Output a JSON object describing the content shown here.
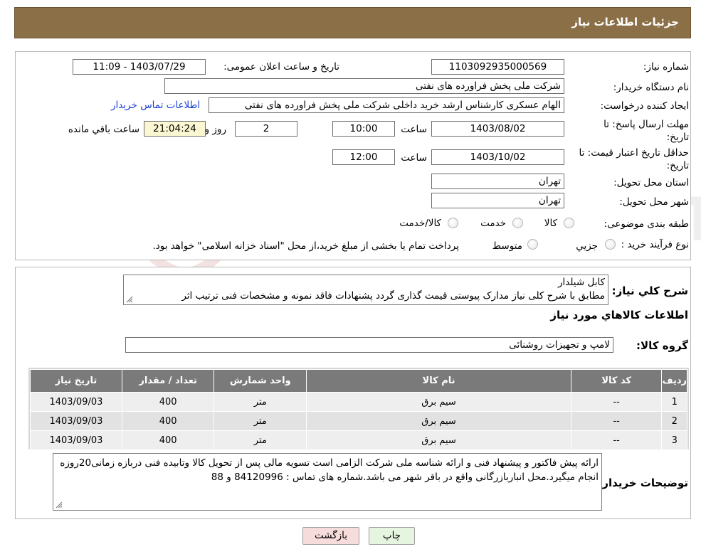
{
  "header": {
    "title": "جزئیات اطلاعات نیاز"
  },
  "form": {
    "need_number_label": "شماره نیاز:",
    "need_number": "1103092935000569",
    "announce_label": "تاریخ و ساعت اعلان عمومی:",
    "announce_value": "1403/07/29 - 11:09",
    "buyer_org_label": "نام دستگاه خریدار:",
    "buyer_org": "شرکت ملی پخش فراورده های نفتی",
    "creator_label": "ایجاد کننده درخواست:",
    "creator": "الهام عسکری کارشناس ارشد خرید داخلی شرکت ملی پخش فراورده های نفتی",
    "contact_link": "اطلاعات تماس خریدار",
    "deadline_label": "مهلت ارسال پاسخ: تا تاریخ:",
    "deadline_date": "1403/08/02",
    "time_label": "ساعت",
    "deadline_time": "10:00",
    "days_value": "2",
    "days_label": "روز و",
    "remaining_value": "21:04:24",
    "remaining_label": "ساعت باقي مانده",
    "validity_label": "حداقل تاریخ اعتبار قیمت: تا تاریخ:",
    "validity_date": "1403/10/02",
    "validity_time": "12:00",
    "province_label": "استان محل تحویل:",
    "province": "تهران",
    "city_label": "شهر محل تحویل:",
    "city": "تهران",
    "category_label": "طبقه بندی موضوعی:",
    "category_options": [
      "کالا",
      "خدمت",
      "کالا/خدمت"
    ],
    "process_label": "نوع فرآیند خرید :",
    "process_options": [
      "جزیي",
      "متوسط"
    ],
    "process_note": "پرداخت تمام یا بخشی از مبلغ خرید،از محل \"اسناد خزانه اسلامی\" خواهد بود."
  },
  "details": {
    "summary_label": "شرح کلي نیاز:",
    "summary_line1": "کابل شیلدار",
    "summary_line2": "مطابق با شرح کلی نیاز مدارک پیوستی قیمت گذاری گردد پشنهادات فاقد نمونه و مشخصات فنی ترتیب اثر",
    "goods_info_title": "اطلاعات کالاهاي مورد نیاز",
    "group_label": "گروه کالا:",
    "group_value": "لامپ و تجهیزات روشنائی",
    "table": {
      "headers": [
        "ردیف",
        "کد کالا",
        "نام کالا",
        "واحد شمارش",
        "تعداد / مقدار",
        "تاریخ نیاز"
      ],
      "rows": [
        [
          "1",
          "--",
          "سیم برق",
          "متر",
          "400",
          "1403/09/03"
        ],
        [
          "2",
          "--",
          "سیم برق",
          "متر",
          "400",
          "1403/09/03"
        ],
        [
          "3",
          "--",
          "سیم برق",
          "متر",
          "400",
          "1403/09/03"
        ]
      ]
    },
    "buyer_notes_label": "توضیحات خریدار:",
    "buyer_notes": "ارائه پیش فاکتور و پیشنهاد فنی و ارائه شناسه ملی شرکت الزامی است تسویه مالی پس از تحویل کالا وتابیده فنی دربازه زمانی20روزه انجام میگیرد.محل انباربازرگانی واقع در باقر شهر می باشد.شماره های تماس : 84120996 و 88"
  },
  "buttons": {
    "print": "چاپ",
    "back": "بازگشت"
  },
  "watermark": {
    "text": "AriaTender.neT"
  },
  "colors": {
    "header_bg": "#8b6f47",
    "table_header_bg": "#7a7a7a",
    "print_bg": "#e6f5e0",
    "back_bg": "#f7dcdc",
    "link": "#1a3fd6"
  }
}
